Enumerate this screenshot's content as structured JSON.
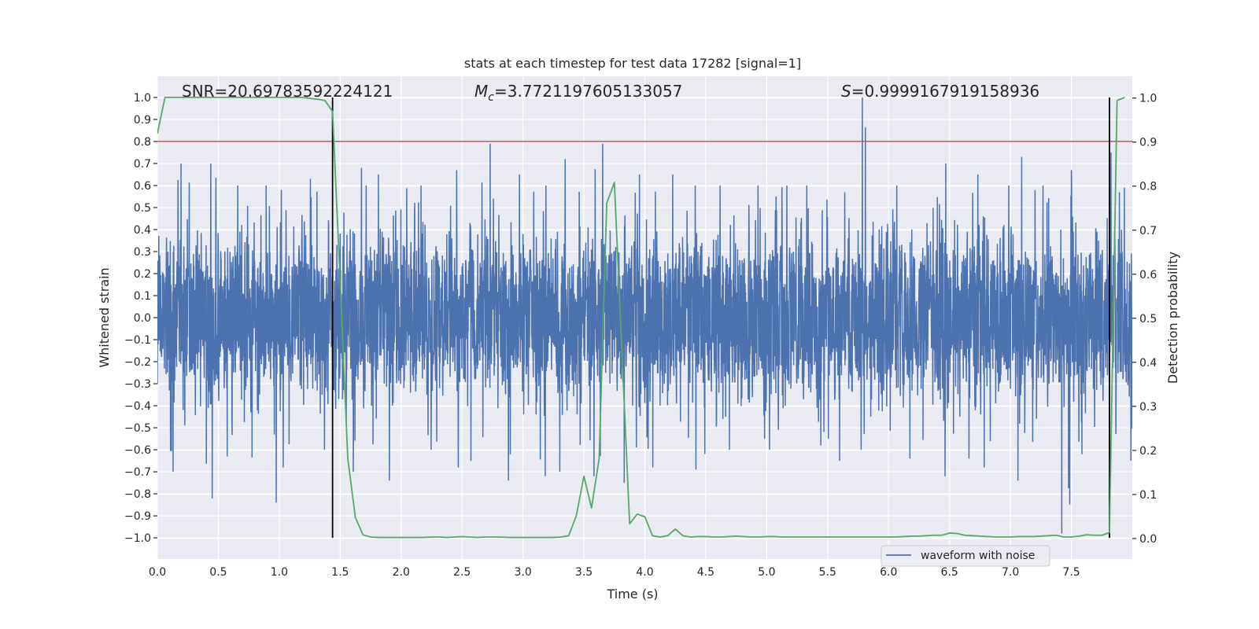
{
  "chart_data": {
    "type": "line",
    "title": "stats at each timestep for test data 17282 [signal=1]",
    "xlabel": "Time (s)",
    "ylabel": "Whitened strain",
    "ylabel_right": "Detection probability",
    "xlim": [
      0,
      8
    ],
    "ylim": [
      -1.096,
      1.096
    ],
    "ylim_right": [
      -0.048,
      1.048
    ],
    "grid": true,
    "legend_placement": "lower-right",
    "x_ticks": [
      "0.0",
      "0.5",
      "1.0",
      "1.5",
      "2.0",
      "2.5",
      "3.0",
      "3.5",
      "4.0",
      "4.5",
      "5.0",
      "5.5",
      "6.0",
      "6.5",
      "7.0",
      "7.5"
    ],
    "y_ticks": [
      "1.0",
      "0.9",
      "0.8",
      "0.7",
      "0.6",
      "0.5",
      "0.4",
      "0.3",
      "0.2",
      "0.1",
      "0.0",
      "−0.1",
      "−0.2",
      "−0.3",
      "−0.4",
      "−0.5",
      "−0.6",
      "−0.7",
      "−0.8",
      "−0.9",
      "−1.0"
    ],
    "y_ticks_right": [
      "1.0",
      "0.9",
      "0.8",
      "0.7",
      "0.6",
      "0.5",
      "0.4",
      "0.3",
      "0.2",
      "0.1",
      "0.0"
    ],
    "annotations": {
      "snr": "SNR=20.69783592224121",
      "mc_symbol": "M",
      "mc_subscript": "c",
      "mc_value": "=3.7721197605133057",
      "s_symbol": "S",
      "s_value": "=0.9999167919158936"
    },
    "series": [
      {
        "name": "waveform with noise",
        "axis": "left",
        "color": "#4c72b0",
        "envelope_bin_width_s": 0.25,
        "upper_envelope": [
          0.7,
          0.7,
          0.6,
          0.6,
          0.58,
          0.63,
          0.68,
          0.65,
          0.6,
          0.67,
          0.79,
          0.65,
          0.6,
          0.72,
          0.79,
          0.65,
          0.65,
          0.6,
          0.6,
          0.6,
          0.6,
          0.6,
          0.57,
          1.0,
          0.6,
          0.7,
          0.65,
          0.6,
          0.73,
          0.6,
          0.67,
          0.75
        ],
        "lower_envelope": [
          -0.7,
          -0.82,
          -0.63,
          -0.84,
          -0.68,
          -0.6,
          -0.7,
          -0.74,
          -0.6,
          -0.68,
          -0.65,
          -0.74,
          -0.72,
          -0.7,
          -0.72,
          -0.75,
          -0.68,
          -0.69,
          -0.6,
          -0.55,
          -0.6,
          -0.58,
          -0.65,
          -0.6,
          -0.64,
          -0.72,
          -0.64,
          -0.68,
          -0.74,
          -0.98,
          -0.62,
          -0.65
        ]
      },
      {
        "axis": "right",
        "color": "#55a868",
        "x_start": 0,
        "x_step": 0.0625,
        "values": [
          0.918,
          1,
          1,
          1,
          1,
          1,
          1,
          1,
          1,
          1,
          1,
          1,
          1,
          1,
          1,
          1,
          1,
          1,
          1,
          1,
          0.998,
          0.996,
          0.993,
          0.968,
          0.58,
          0.18,
          0.046,
          0.007,
          0.002,
          0.001,
          0.001,
          0.001,
          0.001,
          0.001,
          0.001,
          0.001,
          0.002,
          0.002,
          0.001,
          0.002,
          0.003,
          0.002,
          0.001,
          0.002,
          0.002,
          0.002,
          0.001,
          0.001,
          0.001,
          0.001,
          0.001,
          0.001,
          0.001,
          0.002,
          0.005,
          0.05,
          0.14,
          0.068,
          0.18,
          0.76,
          0.807,
          0.42,
          0.032,
          0.054,
          0.048,
          0.005,
          0.002,
          0.005,
          0.02,
          0.005,
          0.002,
          0.003,
          0.003,
          0.002,
          0.002,
          0.003,
          0.004,
          0.003,
          0.002,
          0.002,
          0.003,
          0.003,
          0.002,
          0.002,
          0.002,
          0.002,
          0.002,
          0.002,
          0.002,
          0.002,
          0.002,
          0.002,
          0.002,
          0.002,
          0.002,
          0.002,
          0.002,
          0.002,
          0.003,
          0.004,
          0.004,
          0.005,
          0.006,
          0.006,
          0.011,
          0.01,
          0.006,
          0.005,
          0.004,
          0.003,
          0.002,
          0.002,
          0.002,
          0.003,
          0.003,
          0.003,
          0.004,
          0.005,
          0.006,
          0.002,
          0.002,
          0.004,
          0.007,
          0.006,
          0.006,
          0.012,
          0.993,
          1.0
        ]
      }
    ],
    "threshold_line": {
      "axis": "right",
      "value": 0.9,
      "color": "#c44e52"
    },
    "vertical_markers": {
      "axis": "right",
      "x": [
        1.4375,
        7.8125
      ],
      "range": [
        0,
        1
      ],
      "color": "#000000"
    },
    "colors": {
      "background": "#eaeaf2",
      "grid": "#ffffff",
      "text": "#262626"
    }
  }
}
